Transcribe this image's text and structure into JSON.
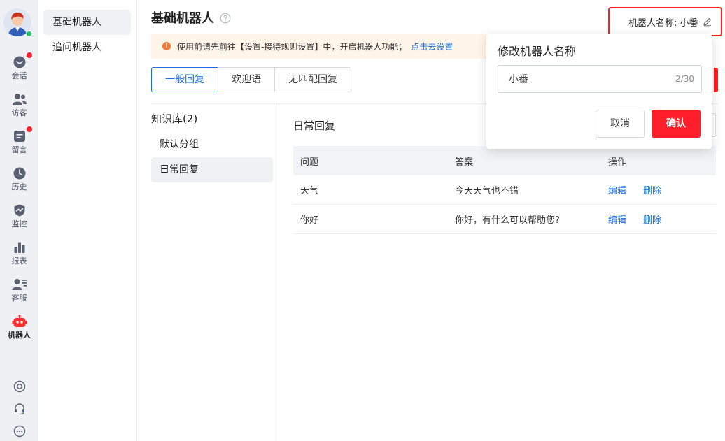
{
  "rail": {
    "items": [
      {
        "label": "会话",
        "icon": "chat-bubble-icon",
        "badge": true
      },
      {
        "label": "访客",
        "icon": "visitors-icon",
        "badge": false
      },
      {
        "label": "留言",
        "icon": "message-note-icon",
        "badge": true
      },
      {
        "label": "历史",
        "icon": "clock-icon",
        "badge": false
      },
      {
        "label": "监控",
        "icon": "monitor-shield-icon",
        "badge": false
      },
      {
        "label": "报表",
        "icon": "bar-chart-icon",
        "badge": false
      },
      {
        "label": "客服",
        "icon": "agent-list-icon",
        "badge": false
      },
      {
        "label": "机器人",
        "icon": "robot-icon",
        "badge": false,
        "active": true
      }
    ],
    "bottom_icons": [
      "target-icon",
      "headset-icon",
      "more-icon"
    ]
  },
  "subnav": {
    "items": [
      {
        "label": "基础机器人",
        "active": true
      },
      {
        "label": "追问机器人",
        "active": false
      }
    ]
  },
  "header": {
    "title": "基础机器人",
    "robot_name_label": "机器人名称: 小番"
  },
  "notice": {
    "text": "使用前请先前往【设置-接待规则设置】中，开启机器人功能；",
    "link": "点击去设置"
  },
  "tabs": [
    {
      "label": "一般回复",
      "active": true
    },
    {
      "label": "欢迎语",
      "active": false
    },
    {
      "label": "无匹配回复",
      "active": false
    }
  ],
  "knowledge": {
    "title": "知识库(2)",
    "groups": [
      {
        "label": "默认分组",
        "active": false
      },
      {
        "label": "日常回复",
        "active": true
      }
    ]
  },
  "section": {
    "title": "日常回复"
  },
  "table": {
    "headers": [
      "问题",
      "答案",
      "操作"
    ],
    "rows": [
      {
        "question": "天气",
        "answer": "今天天气也不错"
      },
      {
        "question": "你好",
        "answer": "你好，有什么可以帮助您?"
      }
    ],
    "actions": {
      "edit": "编辑",
      "delete": "删除"
    }
  },
  "popover": {
    "title": "修改机器人名称",
    "input_value": "小番",
    "counter": "2/30",
    "cancel": "取消",
    "confirm": "确认"
  },
  "colors": {
    "accent": "#1b6fe0",
    "danger": "#ff1f2b",
    "notice_bg": "#fff5e9",
    "warn": "#f57a3a"
  }
}
